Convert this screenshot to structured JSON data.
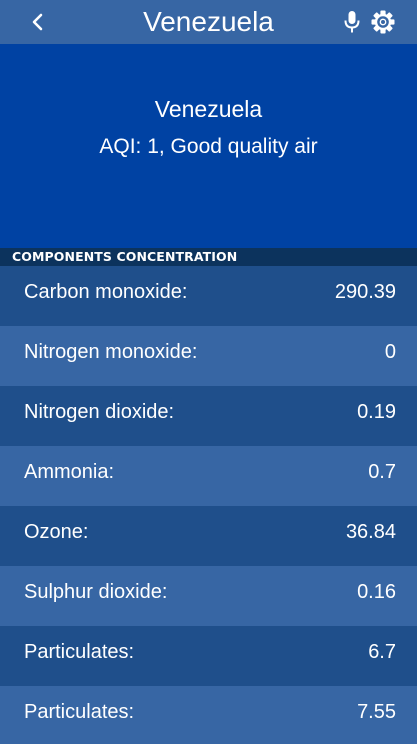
{
  "header": {
    "title": "Venezuela",
    "back_icon": "chevron-left-icon",
    "mic_icon": "microphone-icon",
    "settings_icon": "gear-icon"
  },
  "hero": {
    "city": "Venezuela",
    "aqi_text": "AQI: 1, Good quality air"
  },
  "section": {
    "title": "COMPONENTS CONCENTRATION"
  },
  "components": [
    {
      "label": "Carbon monoxide:",
      "value": "290.39"
    },
    {
      "label": "Nitrogen monoxide:",
      "value": "0"
    },
    {
      "label": "Nitrogen dioxide:",
      "value": "0.19"
    },
    {
      "label": "Ammonia:",
      "value": "0.7"
    },
    {
      "label": "Ozone:",
      "value": "36.84"
    },
    {
      "label": "Sulphur dioxide:",
      "value": "0.16"
    },
    {
      "label": "Particulates:",
      "value": "6.7"
    },
    {
      "label": "Particulates:",
      "value": "7.55"
    }
  ],
  "colors": {
    "topbar": "#3766a4",
    "hero": "#0042a3",
    "section_header": "#0c335d",
    "row_dark": "#1f4f8b",
    "row_light": "#3766a4"
  }
}
